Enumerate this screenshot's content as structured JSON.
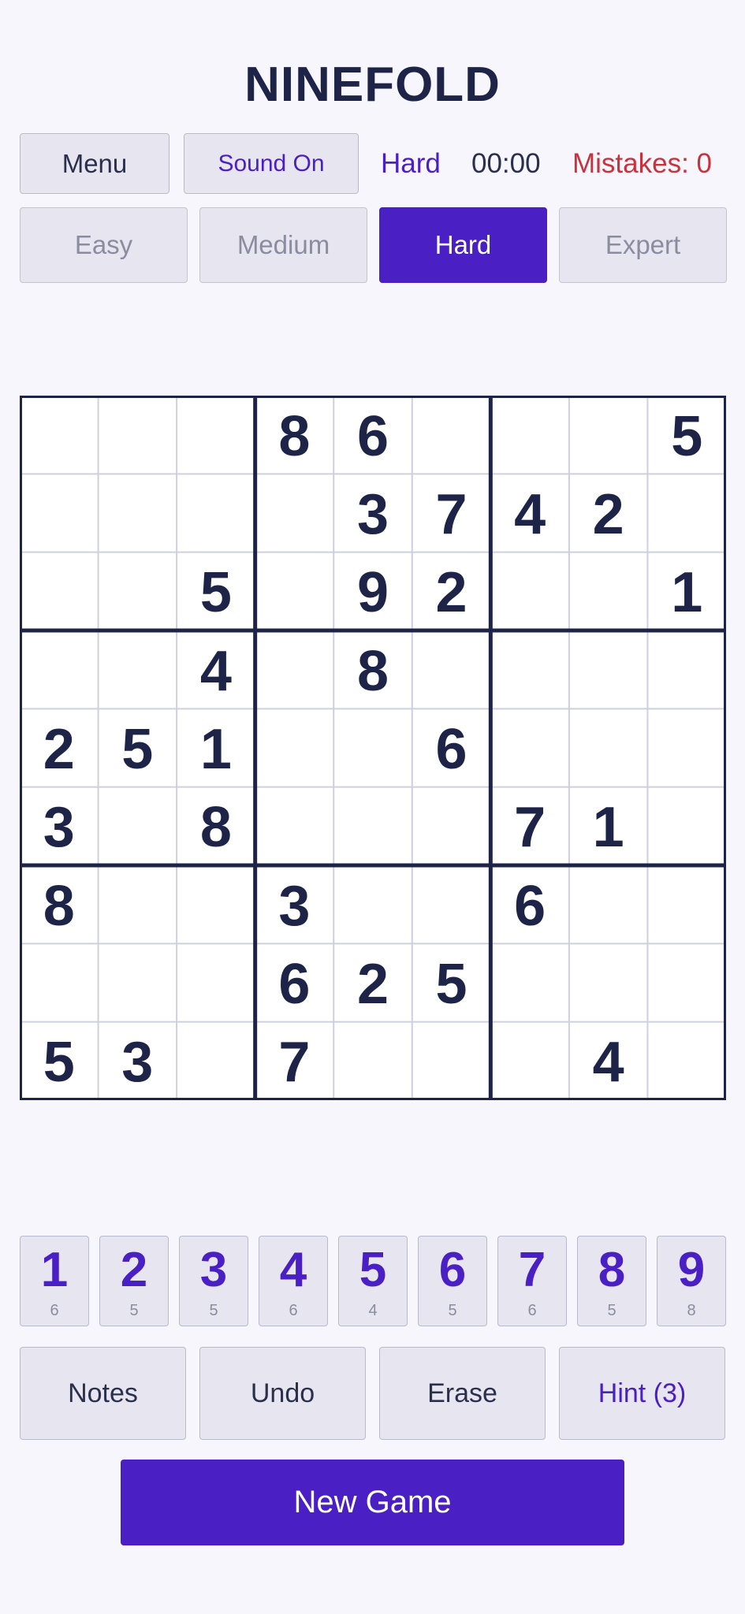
{
  "title": "NINEFOLD",
  "header": {
    "menu_label": "Menu",
    "sound_label": "Sound On",
    "difficulty": "Hard",
    "timer": "00:00",
    "mistakes": "Mistakes: 0"
  },
  "difficulty_tabs": [
    {
      "label": "Easy",
      "active": false
    },
    {
      "label": "Medium",
      "active": false
    },
    {
      "label": "Hard",
      "active": true
    },
    {
      "label": "Expert",
      "active": false
    }
  ],
  "board": [
    [
      "",
      "",
      "",
      "8",
      "6",
      "",
      "",
      "",
      "5"
    ],
    [
      "",
      "",
      "",
      "",
      "3",
      "7",
      "4",
      "2",
      ""
    ],
    [
      "",
      "",
      "5",
      "",
      "9",
      "2",
      "",
      "",
      "1"
    ],
    [
      "",
      "",
      "4",
      "",
      "8",
      "",
      "",
      "",
      ""
    ],
    [
      "2",
      "5",
      "1",
      "",
      "",
      "6",
      "",
      "",
      ""
    ],
    [
      "3",
      "",
      "8",
      "",
      "",
      "",
      "7",
      "1",
      ""
    ],
    [
      "8",
      "",
      "",
      "3",
      "",
      "",
      "6",
      "",
      ""
    ],
    [
      "",
      "",
      "",
      "6",
      "2",
      "5",
      "",
      "",
      ""
    ],
    [
      "5",
      "3",
      "",
      "7",
      "",
      "",
      "",
      "4",
      ""
    ]
  ],
  "number_pad": [
    {
      "digit": "1",
      "count": "6"
    },
    {
      "digit": "2",
      "count": "5"
    },
    {
      "digit": "3",
      "count": "5"
    },
    {
      "digit": "4",
      "count": "6"
    },
    {
      "digit": "5",
      "count": "4"
    },
    {
      "digit": "6",
      "count": "5"
    },
    {
      "digit": "7",
      "count": "6"
    },
    {
      "digit": "8",
      "count": "5"
    },
    {
      "digit": "9",
      "count": "8"
    }
  ],
  "actions": {
    "notes": "Notes",
    "undo": "Undo",
    "erase": "Erase",
    "hint": "Hint (3)"
  },
  "new_game_label": "New Game",
  "colors": {
    "accent": "#4a1fc4",
    "ink": "#1e2447",
    "error": "#c8323c",
    "background": "#f6f6fc"
  }
}
